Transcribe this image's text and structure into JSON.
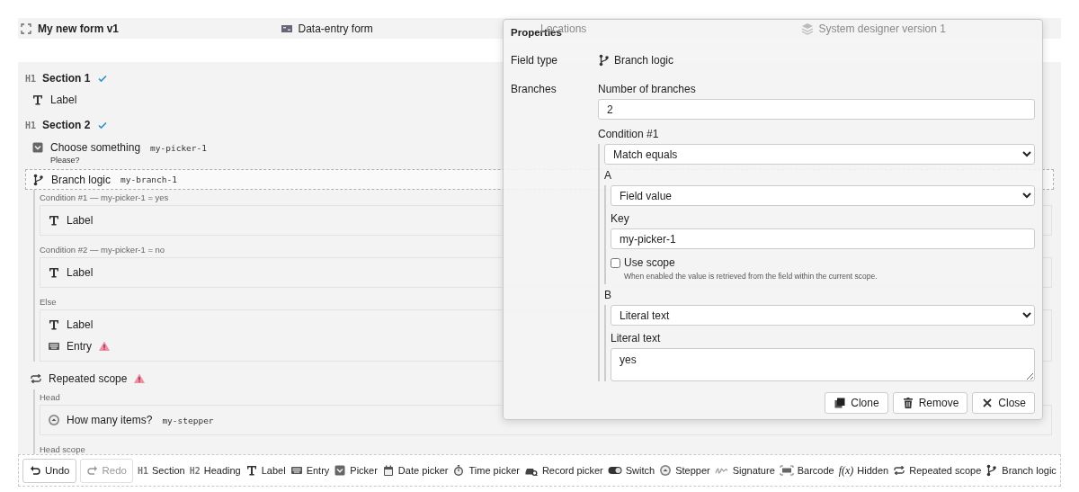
{
  "header": {
    "title": "My new form v1",
    "items": [
      {
        "kind": "form",
        "label": "Data-entry form"
      },
      {
        "label": "Locations"
      },
      {
        "kind": "layers",
        "label": "System designer version 1"
      }
    ]
  },
  "form": {
    "items": [
      {
        "kind": "section",
        "badge": "H1",
        "label": "Section 1",
        "valid": true,
        "selected": false,
        "warning": false
      },
      {
        "kind": "label",
        "label": "Label",
        "selected": false,
        "warning": false
      },
      {
        "kind": "section",
        "badge": "H1",
        "label": "Section 2",
        "valid": true,
        "selected": false,
        "warning": false
      },
      {
        "kind": "picker",
        "label": "Choose something",
        "key": "my-picker-1",
        "hint": "Please?",
        "selected": false,
        "warning": false
      },
      {
        "kind": "branch",
        "label": "Branch logic",
        "key": "my-branch-1",
        "selected": true,
        "warning": false,
        "groups": [
          {
            "title": "Condition #1 — my-picker-1 = yes",
            "children": [
              {
                "kind": "label",
                "label": "Label",
                "warning": false
              }
            ]
          },
          {
            "title": "Condition #2 — my-picker-1 = no",
            "children": [
              {
                "kind": "label",
                "label": "Label",
                "warning": false
              }
            ]
          },
          {
            "title": "Else",
            "children": [
              {
                "kind": "label",
                "label": "Label",
                "warning": false
              },
              {
                "kind": "entry",
                "label": "Entry",
                "warning": true
              }
            ]
          }
        ]
      },
      {
        "kind": "repeated",
        "label": "Repeated scope",
        "selected": false,
        "warning": true,
        "groups": [
          {
            "title": "Head",
            "children": [
              {
                "kind": "stepper",
                "label": "How many items?",
                "key": "my-stepper",
                "warning": false
              }
            ]
          },
          {
            "title": "Head scope"
          }
        ]
      }
    ]
  },
  "properties": {
    "title": "Properties",
    "field_type": {
      "label": "Field type",
      "kind": "branch",
      "value": "Branch logic"
    },
    "branches": {
      "label": "Branches",
      "count_label": "Number of branches",
      "count": "2",
      "conditions": [
        {
          "title": "Condition #1",
          "operator": "Match equals",
          "operands": [
            {
              "name": "A",
              "kind": "field",
              "source": "Field value",
              "value_label": "Key",
              "value": "my-picker-1",
              "use_scope": {
                "label": "Use scope",
                "checked": false,
                "help": "When enabled the value is retrieved from the field within the current scope."
              }
            },
            {
              "name": "B",
              "kind": "literal",
              "source": "Literal text",
              "value_label": "Literal text",
              "value": "yes"
            }
          ]
        }
      ]
    },
    "buttons": [
      {
        "kind": "clone",
        "label": "Clone"
      },
      {
        "kind": "remove",
        "label": "Remove"
      },
      {
        "kind": "close",
        "label": "Close"
      }
    ]
  },
  "toolbar": {
    "history": [
      {
        "kind": "undo",
        "label": "Undo",
        "disabled": false
      },
      {
        "kind": "redo",
        "label": "Redo",
        "disabled": true
      }
    ],
    "items": [
      {
        "kind": "section",
        "badge": "H1",
        "label": "Section"
      },
      {
        "kind": "heading",
        "badge": "H2",
        "label": "Heading"
      },
      {
        "kind": "label",
        "label": "Label"
      },
      {
        "kind": "entry",
        "label": "Entry"
      },
      {
        "kind": "picker",
        "label": "Picker"
      },
      {
        "kind": "date",
        "label": "Date picker"
      },
      {
        "kind": "time",
        "label": "Time picker"
      },
      {
        "kind": "record",
        "label": "Record picker"
      },
      {
        "kind": "switch",
        "label": "Switch"
      },
      {
        "kind": "stepper",
        "label": "Stepper"
      },
      {
        "kind": "signature",
        "label": "Signature"
      },
      {
        "kind": "barcode",
        "label": "Barcode"
      },
      {
        "kind": "hidden",
        "badge": "f(x)",
        "label": "Hidden"
      },
      {
        "kind": "repeated",
        "label": "Repeated scope"
      },
      {
        "kind": "branch",
        "label": "Branch logic"
      }
    ]
  }
}
